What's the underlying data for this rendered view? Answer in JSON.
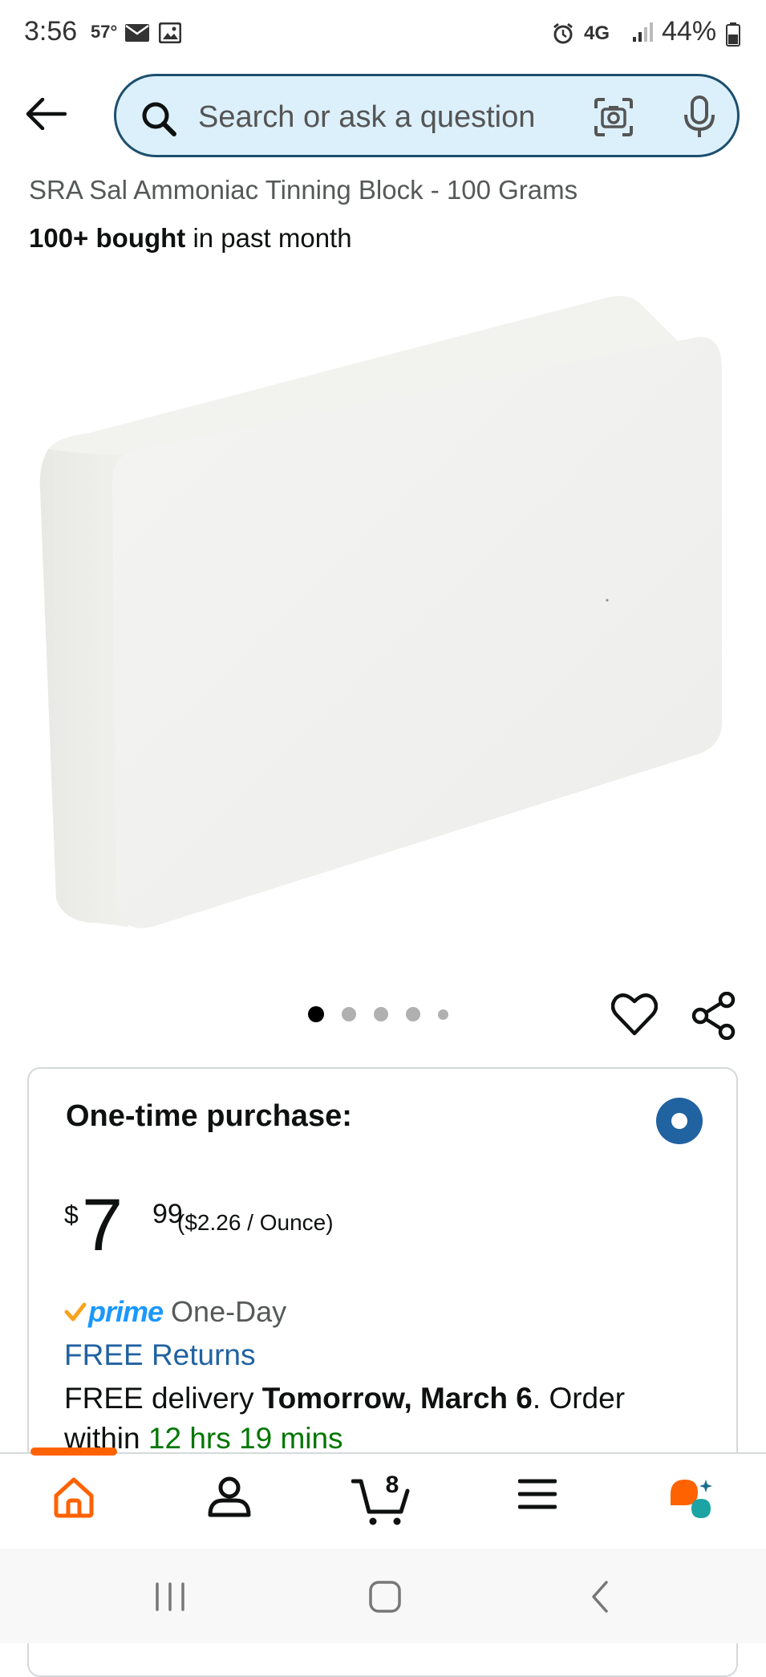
{
  "status_bar": {
    "time": "3:56",
    "temperature": "57°",
    "network": "4G",
    "battery": "44%"
  },
  "search": {
    "placeholder": "Search or ask a question"
  },
  "product": {
    "title": "SRA Sal Ammoniac Tinning Block - 100 Grams",
    "bought_count": "100+ bought",
    "bought_suffix": " in past month",
    "image_count": 5,
    "active_image": 1
  },
  "purchase": {
    "option_title": "One-time purchase:",
    "price_symbol": "$",
    "price_whole": "7",
    "price_fraction": "99",
    "unit_price": "($2.26 / Ounce)",
    "prime_label": "prime",
    "prime_speed": "One-Day",
    "free_returns": "FREE Returns",
    "delivery_prefix": "FREE delivery ",
    "delivery_date": "Tomorrow, March 6",
    "delivery_middle": ". Order within ",
    "delivery_countdown": "12 hrs 19 mins"
  },
  "bottom_nav": {
    "cart_count": "8",
    "items": [
      "home",
      "account",
      "cart",
      "menu",
      "rufus"
    ]
  },
  "colors": {
    "accent_orange": "#ff6200",
    "link_blue": "#2162a1",
    "prime_blue": "#1a98ff",
    "countdown_green": "#007600",
    "search_bg": "#dcf0fb"
  }
}
